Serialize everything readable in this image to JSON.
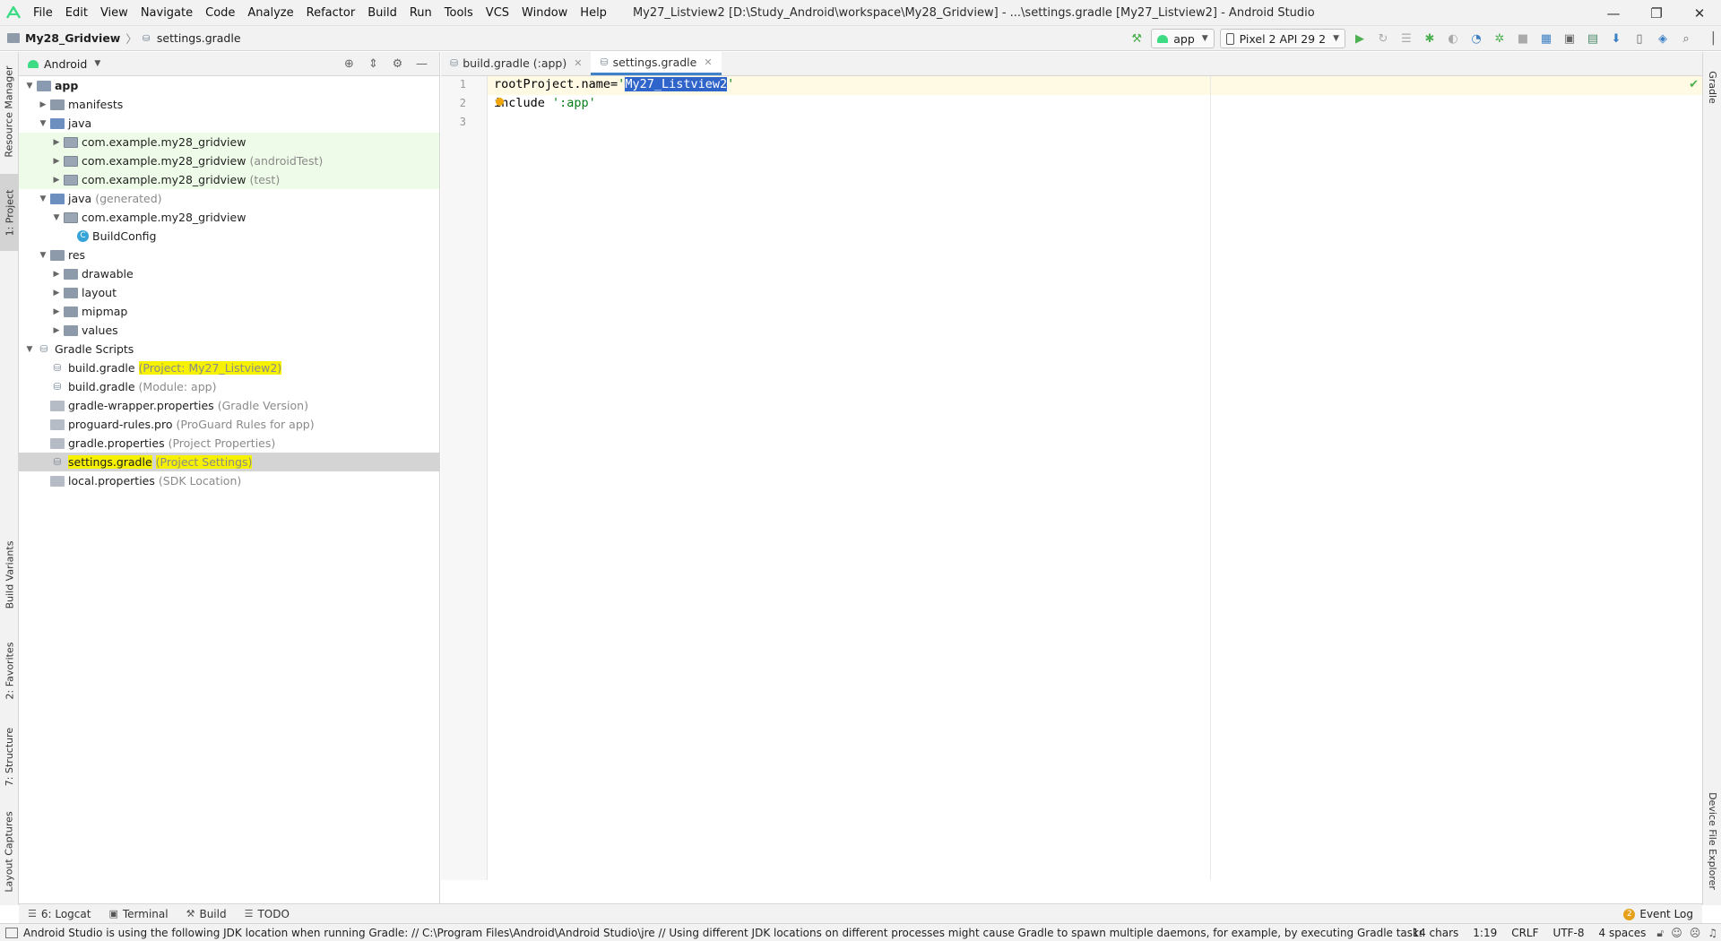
{
  "menubar": {
    "items": [
      "File",
      "Edit",
      "View",
      "Navigate",
      "Code",
      "Analyze",
      "Refactor",
      "Build",
      "Run",
      "Tools",
      "VCS",
      "Window",
      "Help"
    ],
    "window_title": "My27_Listview2 [D:\\Study_Android\\workspace\\My28_Gridview] - ...\\settings.gradle [My27_Listview2] - Android Studio",
    "win_minimize": "—",
    "win_restore": "❐",
    "win_close": "✕"
  },
  "navbar": {
    "project": "My28_Gridview",
    "file": "settings.gradle",
    "run_config": "app",
    "device": "Pixel 2 API 29 2"
  },
  "left_stripe": {
    "resource_manager": "Resource Manager",
    "project": "1: Project",
    "build_variants": "Build Variants",
    "favorites": "2: Favorites",
    "structure": "7: Structure",
    "layout_captures": "Layout Captures"
  },
  "right_stripe": {
    "gradle": "Gradle",
    "device_file_explorer": "Device File Explorer"
  },
  "project_panel": {
    "view_mode": "Android",
    "tree": [
      {
        "label": "app",
        "hint": "",
        "depth": 0,
        "expanded": true,
        "kind": "module",
        "bold": true
      },
      {
        "label": "manifests",
        "hint": "",
        "depth": 1,
        "expanded": false,
        "kind": "folder"
      },
      {
        "label": "java",
        "hint": "",
        "depth": 1,
        "expanded": true,
        "kind": "folder-blue"
      },
      {
        "label": "com.example.my28_gridview",
        "hint": "",
        "depth": 2,
        "expanded": false,
        "kind": "pkg",
        "green": true
      },
      {
        "label": "com.example.my28_gridview",
        "hint": "(androidTest)",
        "depth": 2,
        "expanded": false,
        "kind": "pkg",
        "green": true
      },
      {
        "label": "com.example.my28_gridview",
        "hint": "(test)",
        "depth": 2,
        "expanded": false,
        "kind": "pkg",
        "green": true
      },
      {
        "label": "java",
        "hint": "(generated)",
        "depth": 1,
        "expanded": true,
        "kind": "folder-blue"
      },
      {
        "label": "com.example.my28_gridview",
        "hint": "",
        "depth": 2,
        "expanded": true,
        "kind": "pkg"
      },
      {
        "label": "BuildConfig",
        "hint": "",
        "depth": 3,
        "expanded": null,
        "kind": "cls"
      },
      {
        "label": "res",
        "hint": "",
        "depth": 1,
        "expanded": true,
        "kind": "folder"
      },
      {
        "label": "drawable",
        "hint": "",
        "depth": 2,
        "expanded": false,
        "kind": "folder"
      },
      {
        "label": "layout",
        "hint": "",
        "depth": 2,
        "expanded": false,
        "kind": "folder"
      },
      {
        "label": "mipmap",
        "hint": "",
        "depth": 2,
        "expanded": false,
        "kind": "folder"
      },
      {
        "label": "values",
        "hint": "",
        "depth": 2,
        "expanded": false,
        "kind": "folder"
      },
      {
        "label": "Gradle Scripts",
        "hint": "",
        "depth": 0,
        "expanded": true,
        "kind": "gradle"
      },
      {
        "label": "build.gradle",
        "hint": "(Project: My27_Listview2)",
        "depth": 1,
        "expanded": null,
        "kind": "gradle",
        "hint_highlight": true
      },
      {
        "label": "build.gradle",
        "hint": "(Module: app)",
        "depth": 1,
        "expanded": null,
        "kind": "gradle"
      },
      {
        "label": "gradle-wrapper.properties",
        "hint": "(Gradle Version)",
        "depth": 1,
        "expanded": null,
        "kind": "props"
      },
      {
        "label": "proguard-rules.pro",
        "hint": "(ProGuard Rules for app)",
        "depth": 1,
        "expanded": null,
        "kind": "props"
      },
      {
        "label": "gradle.properties",
        "hint": "(Project Properties)",
        "depth": 1,
        "expanded": null,
        "kind": "props"
      },
      {
        "label": "settings.gradle",
        "hint": "(Project Settings)",
        "depth": 1,
        "expanded": null,
        "kind": "gradle",
        "selected": true,
        "label_highlight": true,
        "hint_highlight": true
      },
      {
        "label": "local.properties",
        "hint": "(SDK Location)",
        "depth": 1,
        "expanded": null,
        "kind": "props"
      }
    ]
  },
  "editor": {
    "tabs": [
      {
        "label": "build.gradle (:app)",
        "active": false
      },
      {
        "label": "settings.gradle",
        "active": true
      }
    ],
    "line_numbers": [
      "1",
      "2",
      "3"
    ],
    "line1_prefix": "rootProject.name=",
    "line1_quote_open": "'",
    "line1_selected": "My27_Listview2",
    "line1_quote_close": "'",
    "line2_keyword": "include",
    "line2_string": "':app'",
    "line3": ""
  },
  "bottom_tools": {
    "logcat": "6: Logcat",
    "terminal": "Terminal",
    "build": "Build",
    "todo": "TODO",
    "event_log": "Event Log",
    "event_count": "2"
  },
  "statusbar": {
    "message": "Android Studio is using the following JDK location when running Gradle: // C:\\Program Files\\Android\\Android Studio\\jre // Using different JDK locations on different processes might cause Gradle to spawn multiple daemons, for example, by executing Gradle tasks fr... (a minute ago)",
    "chars": "14 chars",
    "position": "1:19",
    "line_sep": "CRLF",
    "encoding": "UTF-8",
    "indent": "4 spaces"
  },
  "colors": {
    "selection": "#2f65ca",
    "highlight_yellow": "#f6f100",
    "string_green": "#067d17",
    "android_green": "#3ddc84"
  }
}
